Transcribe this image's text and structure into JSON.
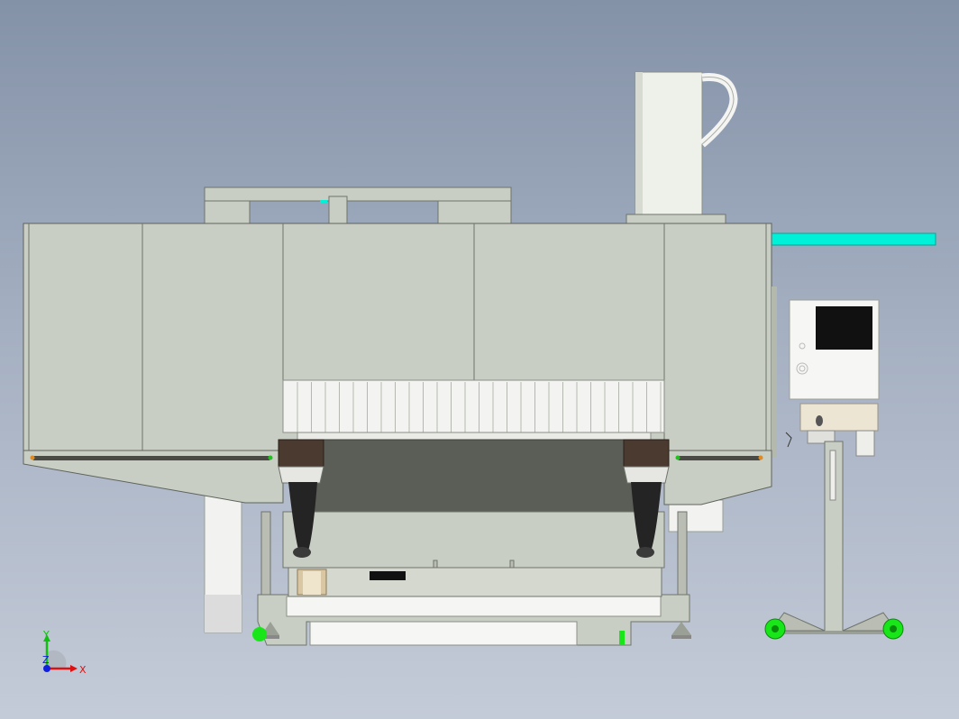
{
  "viewport": {
    "background_top": "#8492a8",
    "background_bottom": "#c4cbd8"
  },
  "model": {
    "body_color": "#c9cec4",
    "edge_color": "#6f746c",
    "accent_color": "#00f0d8",
    "wheel_color": "#19e619",
    "bracket_color": "#4a3a30",
    "screen_color": "#111111"
  },
  "triad": {
    "x_label": "X",
    "y_label": "Y",
    "z_label": "Z",
    "x_color": "#e01010",
    "y_color": "#10c010",
    "z_color": "#1020e0"
  }
}
